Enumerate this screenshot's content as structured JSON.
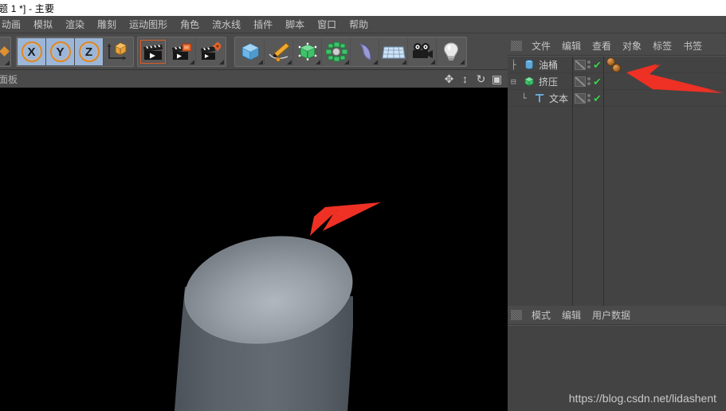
{
  "window": {
    "title": "题 1 *] - 主要"
  },
  "menubar": {
    "items": [
      {
        "label": "动画",
        "name": "menu-animation"
      },
      {
        "label": "模拟",
        "name": "menu-simulate"
      },
      {
        "label": "渲染",
        "name": "menu-render"
      },
      {
        "label": "雕刻",
        "name": "menu-sculpt"
      },
      {
        "label": "运动图形",
        "name": "menu-mograph"
      },
      {
        "label": "角色",
        "name": "menu-character"
      },
      {
        "label": "流水线",
        "name": "menu-pipeline"
      },
      {
        "label": "插件",
        "name": "menu-plugins"
      },
      {
        "label": "脚本",
        "name": "menu-script"
      },
      {
        "label": "窗口",
        "name": "menu-window"
      },
      {
        "label": "帮助",
        "name": "menu-help"
      }
    ]
  },
  "toolbar": {
    "axis_locks": [
      {
        "label": "X",
        "name": "lock-x-axis-button",
        "active": true
      },
      {
        "label": "Y",
        "name": "lock-y-axis-button",
        "active": true
      },
      {
        "label": "Z",
        "name": "lock-z-axis-button",
        "active": true
      }
    ],
    "coordinate_system_name": "world-object-coordinate-toggle",
    "render_buttons": [
      {
        "name": "render-view-button"
      },
      {
        "name": "render-to-picture-viewer-button"
      },
      {
        "name": "render-settings-button"
      }
    ],
    "create_buttons": [
      {
        "name": "add-cube-primitive-button"
      },
      {
        "name": "add-spline-pen-button"
      },
      {
        "name": "add-generator-button"
      },
      {
        "name": "add-array-button"
      },
      {
        "name": "add-bend-deformer-button"
      },
      {
        "name": "add-floor-environment-button"
      },
      {
        "name": "add-camera-button"
      },
      {
        "name": "add-light-button"
      }
    ],
    "colors": {
      "axis_ring": "#e08820",
      "axis_active_bg": "#9bb6d8",
      "cube_blue": "#6fb6e8",
      "generator_green": "#3fc26a",
      "nurbs_purple": "#9a9ad6",
      "bar_bg": "#4a4a4a"
    }
  },
  "viewport": {
    "header_menu_text": "面板",
    "nav_icons": [
      {
        "name": "viewport-move-icon",
        "glyph": "✥"
      },
      {
        "name": "viewport-zoom-icon",
        "glyph": "↕"
      },
      {
        "name": "viewport-rotate-icon",
        "glyph": "↻"
      },
      {
        "name": "viewport-maximize-icon",
        "glyph": "▣"
      }
    ],
    "background_color": "#000000",
    "object": {
      "name": "cylinder-mesh",
      "description": "gray shaded cylinder",
      "body_color": "#5a6068",
      "cap_color": "#8f969d"
    },
    "annotation_arrow": {
      "name": "annotation-arrow-viewport",
      "color": "#ee3124",
      "points_to": "cylinder top edge"
    }
  },
  "object_manager": {
    "menu": [
      {
        "label": "文件",
        "name": "om-menu-file"
      },
      {
        "label": "编辑",
        "name": "om-menu-edit"
      },
      {
        "label": "查看",
        "name": "om-menu-view"
      },
      {
        "label": "对象",
        "name": "om-menu-object"
      },
      {
        "label": "标签",
        "name": "om-menu-tags"
      },
      {
        "label": "书签",
        "name": "om-menu-bookmarks"
      }
    ],
    "items": [
      {
        "label": "油桶",
        "name": "object-row-oil-drum",
        "icon": "cylinder-icon",
        "icon_color": "#5fa8d8",
        "depth": 0,
        "tree_glyph": "├",
        "expandable": false,
        "tags": [
          "material-tag",
          "material-tag"
        ]
      },
      {
        "label": "挤压",
        "name": "object-row-extrude",
        "icon": "extrude-generator-icon",
        "icon_color": "#3fc26a",
        "depth": 0,
        "tree_glyph": "⊟",
        "expandable": true,
        "tags": []
      },
      {
        "label": "文本",
        "name": "object-row-text-spline",
        "icon": "text-spline-icon",
        "icon_color": "#6fb6e8",
        "depth": 1,
        "tree_glyph": "└",
        "expandable": false,
        "tags": []
      }
    ],
    "annotation_arrow": {
      "name": "annotation-arrow-object-manager",
      "color": "#ee3124",
      "points_to": "material tags"
    },
    "tag_color": "#b06d26",
    "enabled_check_color": "#3dd14e"
  },
  "attribute_manager": {
    "menu": [
      {
        "label": "模式",
        "name": "am-menu-mode"
      },
      {
        "label": "编辑",
        "name": "am-menu-edit"
      },
      {
        "label": "用户数据",
        "name": "am-menu-userdata"
      }
    ],
    "content": ""
  },
  "watermark": {
    "text": "https://blog.csdn.net/lidashent"
  }
}
